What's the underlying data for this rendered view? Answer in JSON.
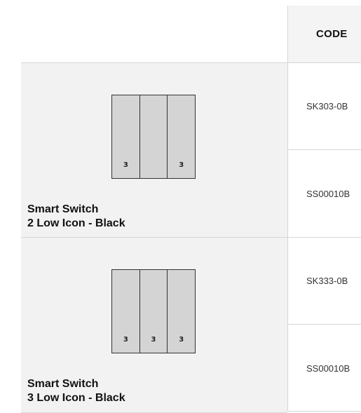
{
  "header": {
    "code_label": "CODE"
  },
  "products": [
    {
      "name_line1": "Smart Switch",
      "name_line2": "2 Low Icon - Black",
      "keys": [
        "3",
        "",
        "3"
      ],
      "codes": [
        "SK303-0B",
        "SS00010B"
      ]
    },
    {
      "name_line1": "Smart Switch",
      "name_line2": "3 Low Icon - Black",
      "keys": [
        "3",
        "3",
        "3"
      ],
      "codes": [
        "SK333-0B",
        "SS00010B"
      ]
    }
  ]
}
